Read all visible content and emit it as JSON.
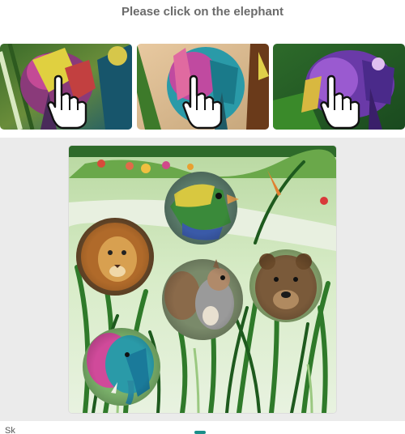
{
  "prompt": "Please click on the elephant",
  "examples": [
    {
      "icon": "pointer-hand-icon",
      "theme": "elephant"
    },
    {
      "icon": "pointer-hand-icon",
      "theme": "elephant"
    },
    {
      "icon": "pointer-hand-icon",
      "theme": "elephant"
    }
  ],
  "puzzle": {
    "animals": [
      "parrot",
      "lion",
      "squirrel",
      "bear",
      "elephant"
    ]
  },
  "footer": {
    "left_text": "Sk"
  },
  "colors": {
    "panel_bg": "#ebebeb",
    "prompt_text": "#6b6b6b",
    "accent": "#1b8f8a"
  }
}
